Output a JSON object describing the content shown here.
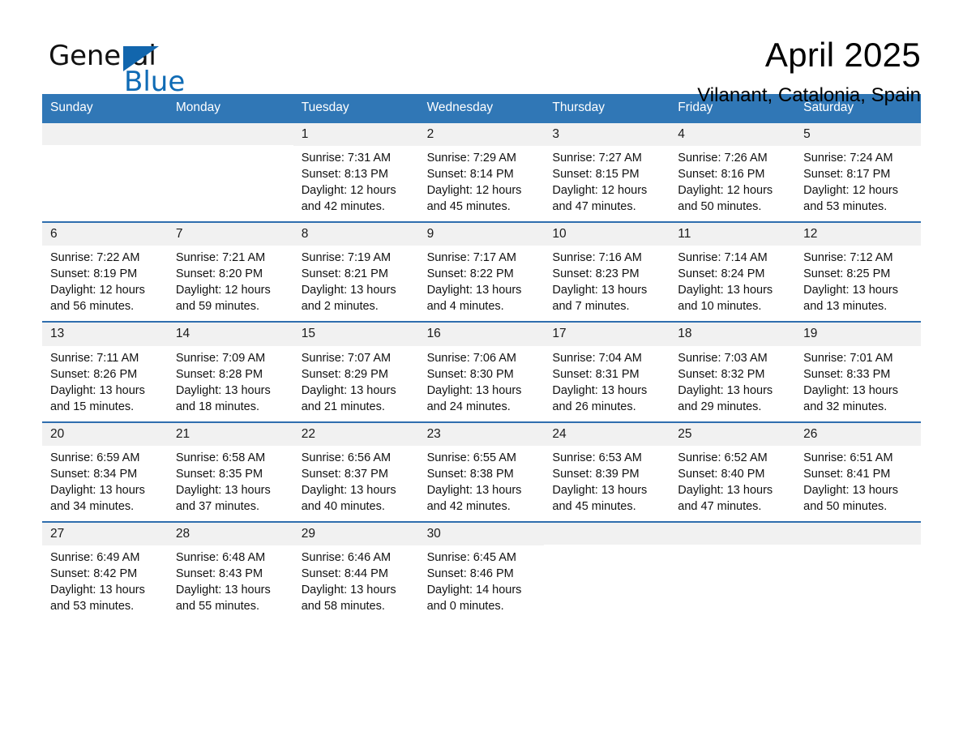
{
  "logo": {
    "word_general": "General",
    "word_blue": "Blue",
    "triangle_color": "#1266ad"
  },
  "header": {
    "title": "April 2025",
    "subtitle": "Vilanant, Catalonia, Spain",
    "accent_color": "#3077b6",
    "row_divider_color": "#2f6eae",
    "daynum_band_color": "#f1f1f1"
  },
  "weekdays": [
    "Sunday",
    "Monday",
    "Tuesday",
    "Wednesday",
    "Thursday",
    "Friday",
    "Saturday"
  ],
  "weeks": [
    [
      {
        "day": "",
        "empty": true
      },
      {
        "day": "",
        "empty": true
      },
      {
        "day": "1",
        "sunrise": "Sunrise: 7:31 AM",
        "sunset": "Sunset: 8:13 PM",
        "daylight1": "Daylight: 12 hours",
        "daylight2": "and 42 minutes."
      },
      {
        "day": "2",
        "sunrise": "Sunrise: 7:29 AM",
        "sunset": "Sunset: 8:14 PM",
        "daylight1": "Daylight: 12 hours",
        "daylight2": "and 45 minutes."
      },
      {
        "day": "3",
        "sunrise": "Sunrise: 7:27 AM",
        "sunset": "Sunset: 8:15 PM",
        "daylight1": "Daylight: 12 hours",
        "daylight2": "and 47 minutes."
      },
      {
        "day": "4",
        "sunrise": "Sunrise: 7:26 AM",
        "sunset": "Sunset: 8:16 PM",
        "daylight1": "Daylight: 12 hours",
        "daylight2": "and 50 minutes."
      },
      {
        "day": "5",
        "sunrise": "Sunrise: 7:24 AM",
        "sunset": "Sunset: 8:17 PM",
        "daylight1": "Daylight: 12 hours",
        "daylight2": "and 53 minutes."
      }
    ],
    [
      {
        "day": "6",
        "sunrise": "Sunrise: 7:22 AM",
        "sunset": "Sunset: 8:19 PM",
        "daylight1": "Daylight: 12 hours",
        "daylight2": "and 56 minutes."
      },
      {
        "day": "7",
        "sunrise": "Sunrise: 7:21 AM",
        "sunset": "Sunset: 8:20 PM",
        "daylight1": "Daylight: 12 hours",
        "daylight2": "and 59 minutes."
      },
      {
        "day": "8",
        "sunrise": "Sunrise: 7:19 AM",
        "sunset": "Sunset: 8:21 PM",
        "daylight1": "Daylight: 13 hours",
        "daylight2": "and 2 minutes."
      },
      {
        "day": "9",
        "sunrise": "Sunrise: 7:17 AM",
        "sunset": "Sunset: 8:22 PM",
        "daylight1": "Daylight: 13 hours",
        "daylight2": "and 4 minutes."
      },
      {
        "day": "10",
        "sunrise": "Sunrise: 7:16 AM",
        "sunset": "Sunset: 8:23 PM",
        "daylight1": "Daylight: 13 hours",
        "daylight2": "and 7 minutes."
      },
      {
        "day": "11",
        "sunrise": "Sunrise: 7:14 AM",
        "sunset": "Sunset: 8:24 PM",
        "daylight1": "Daylight: 13 hours",
        "daylight2": "and 10 minutes."
      },
      {
        "day": "12",
        "sunrise": "Sunrise: 7:12 AM",
        "sunset": "Sunset: 8:25 PM",
        "daylight1": "Daylight: 13 hours",
        "daylight2": "and 13 minutes."
      }
    ],
    [
      {
        "day": "13",
        "sunrise": "Sunrise: 7:11 AM",
        "sunset": "Sunset: 8:26 PM",
        "daylight1": "Daylight: 13 hours",
        "daylight2": "and 15 minutes."
      },
      {
        "day": "14",
        "sunrise": "Sunrise: 7:09 AM",
        "sunset": "Sunset: 8:28 PM",
        "daylight1": "Daylight: 13 hours",
        "daylight2": "and 18 minutes."
      },
      {
        "day": "15",
        "sunrise": "Sunrise: 7:07 AM",
        "sunset": "Sunset: 8:29 PM",
        "daylight1": "Daylight: 13 hours",
        "daylight2": "and 21 minutes."
      },
      {
        "day": "16",
        "sunrise": "Sunrise: 7:06 AM",
        "sunset": "Sunset: 8:30 PM",
        "daylight1": "Daylight: 13 hours",
        "daylight2": "and 24 minutes."
      },
      {
        "day": "17",
        "sunrise": "Sunrise: 7:04 AM",
        "sunset": "Sunset: 8:31 PM",
        "daylight1": "Daylight: 13 hours",
        "daylight2": "and 26 minutes."
      },
      {
        "day": "18",
        "sunrise": "Sunrise: 7:03 AM",
        "sunset": "Sunset: 8:32 PM",
        "daylight1": "Daylight: 13 hours",
        "daylight2": "and 29 minutes."
      },
      {
        "day": "19",
        "sunrise": "Sunrise: 7:01 AM",
        "sunset": "Sunset: 8:33 PM",
        "daylight1": "Daylight: 13 hours",
        "daylight2": "and 32 minutes."
      }
    ],
    [
      {
        "day": "20",
        "sunrise": "Sunrise: 6:59 AM",
        "sunset": "Sunset: 8:34 PM",
        "daylight1": "Daylight: 13 hours",
        "daylight2": "and 34 minutes."
      },
      {
        "day": "21",
        "sunrise": "Sunrise: 6:58 AM",
        "sunset": "Sunset: 8:35 PM",
        "daylight1": "Daylight: 13 hours",
        "daylight2": "and 37 minutes."
      },
      {
        "day": "22",
        "sunrise": "Sunrise: 6:56 AM",
        "sunset": "Sunset: 8:37 PM",
        "daylight1": "Daylight: 13 hours",
        "daylight2": "and 40 minutes."
      },
      {
        "day": "23",
        "sunrise": "Sunrise: 6:55 AM",
        "sunset": "Sunset: 8:38 PM",
        "daylight1": "Daylight: 13 hours",
        "daylight2": "and 42 minutes."
      },
      {
        "day": "24",
        "sunrise": "Sunrise: 6:53 AM",
        "sunset": "Sunset: 8:39 PM",
        "daylight1": "Daylight: 13 hours",
        "daylight2": "and 45 minutes."
      },
      {
        "day": "25",
        "sunrise": "Sunrise: 6:52 AM",
        "sunset": "Sunset: 8:40 PM",
        "daylight1": "Daylight: 13 hours",
        "daylight2": "and 47 minutes."
      },
      {
        "day": "26",
        "sunrise": "Sunrise: 6:51 AM",
        "sunset": "Sunset: 8:41 PM",
        "daylight1": "Daylight: 13 hours",
        "daylight2": "and 50 minutes."
      }
    ],
    [
      {
        "day": "27",
        "sunrise": "Sunrise: 6:49 AM",
        "sunset": "Sunset: 8:42 PM",
        "daylight1": "Daylight: 13 hours",
        "daylight2": "and 53 minutes."
      },
      {
        "day": "28",
        "sunrise": "Sunrise: 6:48 AM",
        "sunset": "Sunset: 8:43 PM",
        "daylight1": "Daylight: 13 hours",
        "daylight2": "and 55 minutes."
      },
      {
        "day": "29",
        "sunrise": "Sunrise: 6:46 AM",
        "sunset": "Sunset: 8:44 PM",
        "daylight1": "Daylight: 13 hours",
        "daylight2": "and 58 minutes."
      },
      {
        "day": "30",
        "sunrise": "Sunrise: 6:45 AM",
        "sunset": "Sunset: 8:46 PM",
        "daylight1": "Daylight: 14 hours",
        "daylight2": "and 0 minutes."
      },
      {
        "day": "",
        "empty": true
      },
      {
        "day": "",
        "empty": true
      },
      {
        "day": "",
        "empty": true
      }
    ]
  ]
}
